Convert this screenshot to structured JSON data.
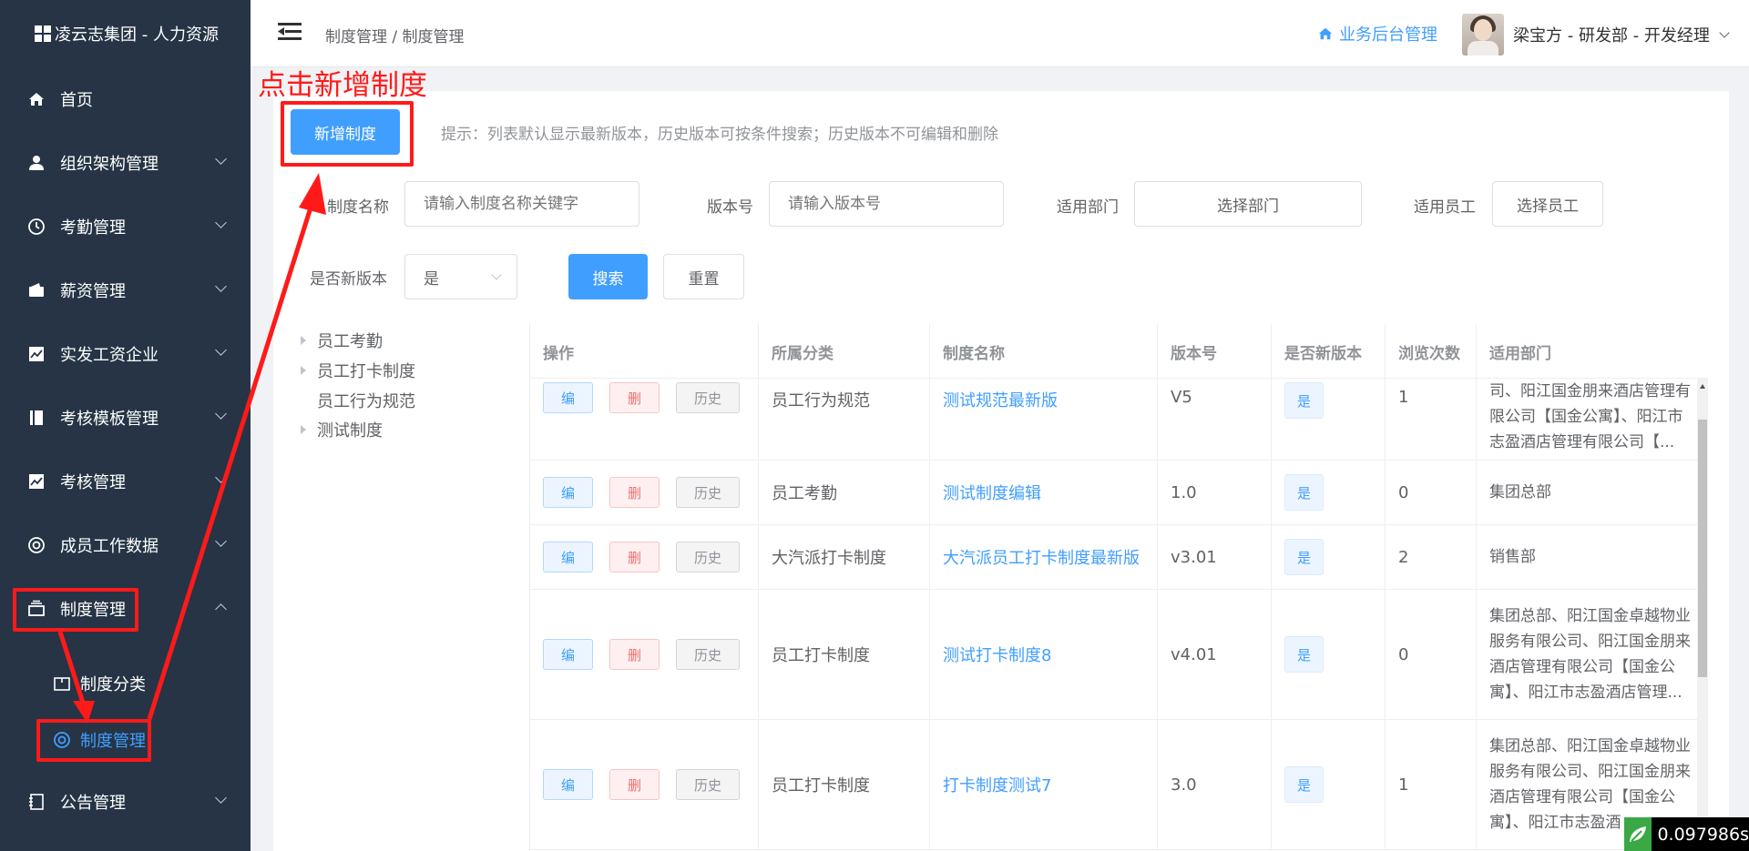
{
  "brand": {
    "title": "凌云志集团 - 人力资源"
  },
  "sidebar": {
    "items": [
      {
        "label": "首页",
        "icon": "home-icon",
        "has_chevron": false
      },
      {
        "label": "组织架构管理",
        "icon": "user-icon",
        "has_chevron": true
      },
      {
        "label": "考勤管理",
        "icon": "clock-icon",
        "has_chevron": true
      },
      {
        "label": "薪资管理",
        "icon": "wallet-icon",
        "has_chevron": true
      },
      {
        "label": "实发工资企业",
        "icon": "chart-icon",
        "has_chevron": true
      },
      {
        "label": "考核模板管理",
        "icon": "book-icon",
        "has_chevron": true
      },
      {
        "label": "考核管理",
        "icon": "chart-icon",
        "has_chevron": true
      },
      {
        "label": "成员工作数据",
        "icon": "lifebuoy-icon",
        "has_chevron": true
      },
      {
        "label": "制度管理",
        "icon": "archive-icon",
        "has_chevron": true,
        "expanded": true
      },
      {
        "label": "公告管理",
        "icon": "notebook-icon",
        "has_chevron": true
      }
    ],
    "sub_items": [
      {
        "label": "制度分类",
        "icon": "folder-icon",
        "active": false
      },
      {
        "label": "制度管理",
        "icon": "lifebuoy-icon",
        "active": true
      }
    ]
  },
  "header": {
    "breadcrumb": "制度管理 / 制度管理",
    "biz_link": "业务后台管理",
    "user": "梁宝方 - 研发部 - 开发经理"
  },
  "toolbar": {
    "add_button": "新增制度",
    "tip": "提示：列表默认显示最新版本，历史版本可按条件搜索；历史版本不可编辑和删除"
  },
  "filters": {
    "name_label": "制度名称",
    "name_placeholder": "请输入制度名称关键字",
    "version_label": "版本号",
    "version_placeholder": "请输入版本号",
    "dept_label": "适用部门",
    "dept_button": "选择部门",
    "emp_label": "适用员工",
    "emp_button": "选择员工",
    "latest_label": "是否新版本",
    "latest_value": "是",
    "search_button": "搜索",
    "reset_button": "重置"
  },
  "tree": [
    {
      "label": "员工考勤",
      "has_children": true
    },
    {
      "label": "员工打卡制度",
      "has_children": true
    },
    {
      "label": "员工行为规范",
      "has_children": false
    },
    {
      "label": "测试制度",
      "has_children": true
    }
  ],
  "table": {
    "columns": [
      "操作",
      "所属分类",
      "制度名称",
      "版本号",
      "是否新版本",
      "浏览次数",
      "适用部门"
    ],
    "action_labels": {
      "edit": "编",
      "delete": "删",
      "history": "历史"
    },
    "rows": [
      {
        "category": "员工行为规范",
        "name": "测试规范最新版",
        "version": "V5",
        "latest": "是",
        "views": "1",
        "dept": "司、阳江国金朋来酒店管理有限公司【国金公寓】、阳江市志盈酒店管理有限公司【..."
      },
      {
        "category": "员工考勤",
        "name": "测试制度编辑",
        "version": "1.0",
        "latest": "是",
        "views": "0",
        "dept": "集团总部"
      },
      {
        "category": "大汽派打卡制度",
        "name": "大汽派员工打卡制度最新版",
        "version": "v3.01",
        "latest": "是",
        "views": "2",
        "dept": "销售部"
      },
      {
        "category": "员工打卡制度",
        "name": "测试打卡制度8",
        "version": "v4.01",
        "latest": "是",
        "views": "0",
        "dept": "集团总部、阳江国金卓越物业服务有限公司、阳江国金朋来酒店管理有限公司【国金公寓】、阳江市志盈酒店管理..."
      },
      {
        "category": "员工打卡制度",
        "name": "打卡制度测试7",
        "version": "3.0",
        "latest": "是",
        "views": "1",
        "dept": "集团总部、阳江国金卓越物业服务有限公司、阳江国金朋来酒店管理有限公司【国金公寓】、阳江市志盈酒"
      }
    ]
  },
  "annotation": {
    "text": "点击新增制度",
    "color": "#ff1a1a"
  },
  "timer": {
    "value": "0.097986s"
  },
  "colors": {
    "sidebar_bg": "#263445",
    "primary": "#409eff",
    "danger": "#f56c6c"
  }
}
